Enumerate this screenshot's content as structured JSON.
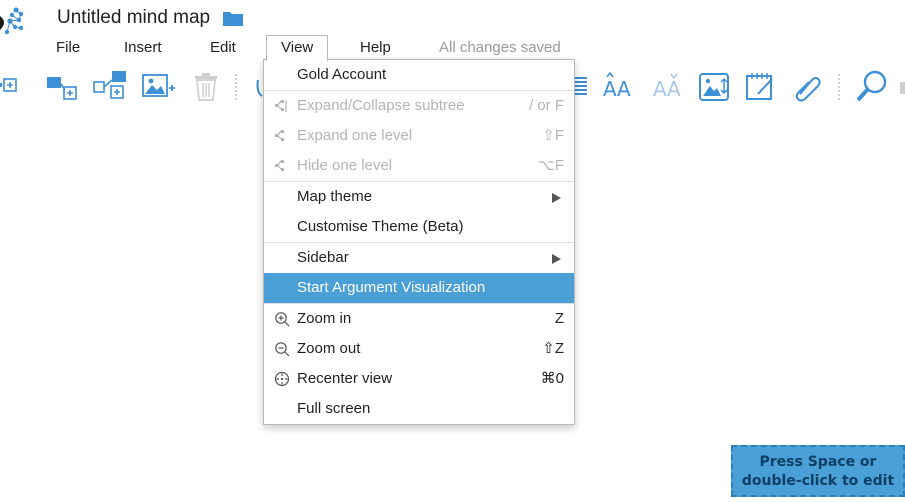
{
  "document": {
    "title": "Untitled mind map",
    "save_status": "All changes saved"
  },
  "menubar": {
    "items": [
      {
        "label": "File"
      },
      {
        "label": "Insert"
      },
      {
        "label": "Edit"
      },
      {
        "label": "View",
        "open": true
      },
      {
        "label": "Help"
      }
    ]
  },
  "toolbar": {
    "icons": [
      "add-child-node-icon",
      "add-sibling-node-icon",
      "add-linked-node-icon",
      "add-image-icon",
      "delete-icon",
      "text-align-icon",
      "increase-font-icon",
      "decrease-font-icon",
      "image-size-icon",
      "note-icon",
      "attach-link-icon",
      "search-icon"
    ]
  },
  "view_menu": {
    "items": [
      {
        "label": "Gold Account",
        "shortcut": "",
        "disabled": false,
        "icon": ""
      },
      {
        "label": "Expand/Collapse subtree",
        "shortcut": "/ or F",
        "disabled": true,
        "icon": "subtree-icon",
        "sep": true
      },
      {
        "label": "Expand one level",
        "shortcut": "⇧F",
        "disabled": true,
        "icon": "expand-level-icon"
      },
      {
        "label": "Hide one level",
        "shortcut": "⌥F",
        "disabled": true,
        "icon": "hide-level-icon"
      },
      {
        "label": "Map theme",
        "shortcut": "",
        "disabled": false,
        "icon": "",
        "submenu": true,
        "sep": true
      },
      {
        "label": "Customise Theme (Beta)",
        "shortcut": "",
        "disabled": false,
        "icon": ""
      },
      {
        "label": "Sidebar",
        "shortcut": "",
        "disabled": false,
        "icon": "",
        "submenu": true,
        "sep": true
      },
      {
        "label": "Start Argument Visualization",
        "shortcut": "",
        "disabled": false,
        "icon": "",
        "highlighted": true
      },
      {
        "label": "Zoom in",
        "shortcut": "Z",
        "disabled": false,
        "icon": "zoom-in-icon",
        "sep": true
      },
      {
        "label": "Zoom out",
        "shortcut": "⇧Z",
        "disabled": false,
        "icon": "zoom-out-icon"
      },
      {
        "label": "Recenter view",
        "shortcut": "⌘0",
        "disabled": false,
        "icon": "recenter-icon"
      },
      {
        "label": "Full screen",
        "shortcut": "",
        "disabled": false,
        "icon": ""
      }
    ]
  },
  "canvas": {
    "node_hint": "Press Space or double-click to edit"
  },
  "colors": {
    "accent": "#4aa0d6",
    "accent_dark": "#2d7fb9",
    "disabled_text": "#b4b4b4",
    "icon_blue": "#3d8fd6"
  }
}
